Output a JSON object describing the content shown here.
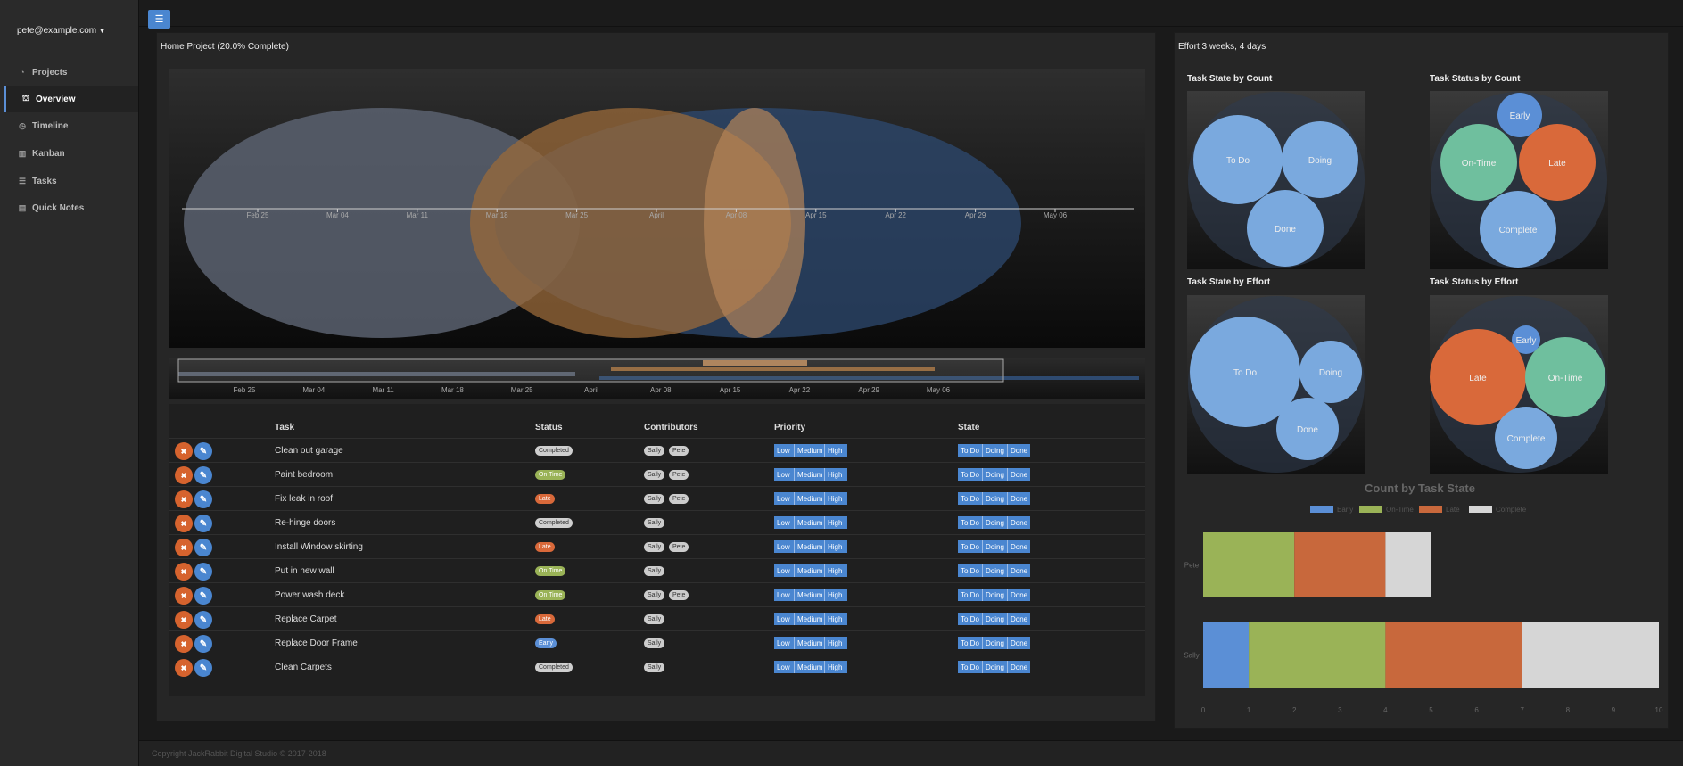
{
  "user": {
    "email": "pete@example.com"
  },
  "nav": [
    {
      "label": "Projects",
      "icon": "dashboard-icon",
      "glyph": "◔",
      "active": false
    },
    {
      "label": "Overview",
      "icon": "binoculars-icon",
      "glyph": "⛫",
      "active": true
    },
    {
      "label": "Timeline",
      "icon": "clock-icon",
      "glyph": "◷",
      "active": false
    },
    {
      "label": "Kanban",
      "icon": "columns-icon",
      "glyph": "▥",
      "active": false
    },
    {
      "label": "Tasks",
      "icon": "list-icon",
      "glyph": "☰",
      "active": false
    },
    {
      "label": "Quick Notes",
      "icon": "book-icon",
      "glyph": "▤",
      "active": false
    }
  ],
  "project": {
    "title": "Home Project (20.0% Complete)"
  },
  "effort": {
    "title": "Effort 3 weeks, 4 days"
  },
  "timeline": {
    "ticks": [
      "Feb 25",
      "Mar 04",
      "Mar 11",
      "Mar 18",
      "Mar 25",
      "April",
      "Apr 08",
      "Apr 15",
      "Apr 22",
      "Apr 29",
      "May 06"
    ],
    "nav_ticks": [
      "Feb 25",
      "Mar 04",
      "Mar 11",
      "Mar 18",
      "Mar 25",
      "April",
      "Apr 08",
      "Apr 15",
      "Apr 22",
      "Apr 29",
      "May 06"
    ]
  },
  "table": {
    "headers": {
      "task": "Task",
      "status": "Status",
      "contributors": "Contributors",
      "priority": "Priority",
      "state": "State"
    },
    "priority_labels": [
      "Low",
      "Medium",
      "High"
    ],
    "state_labels": [
      "To Do",
      "Doing",
      "Done"
    ],
    "rows": [
      {
        "task": "Clean out garage",
        "status": "Completed",
        "contributors": [
          "Sally",
          "Pete"
        ]
      },
      {
        "task": "Paint bedroom",
        "status": "On Time",
        "contributors": [
          "Sally",
          "Pete"
        ]
      },
      {
        "task": "Fix leak in roof",
        "status": "Late",
        "contributors": [
          "Sally",
          "Pete"
        ]
      },
      {
        "task": "Re-hinge doors",
        "status": "Completed",
        "contributors": [
          "Sally"
        ]
      },
      {
        "task": "Install Window skirting",
        "status": "Late",
        "contributors": [
          "Sally",
          "Pete"
        ]
      },
      {
        "task": "Put in new wall",
        "status": "On Time",
        "contributors": [
          "Sally"
        ]
      },
      {
        "task": "Power wash deck",
        "status": "On Time",
        "contributors": [
          "Sally",
          "Pete"
        ]
      },
      {
        "task": "Replace Carpet",
        "status": "Late",
        "contributors": [
          "Sally"
        ]
      },
      {
        "task": "Replace Door Frame",
        "status": "Early",
        "contributors": [
          "Sally"
        ]
      },
      {
        "task": "Clean Carpets",
        "status": "Completed",
        "contributors": [
          "Sally"
        ]
      }
    ]
  },
  "colors": {
    "early": "#5b8fd6",
    "on_time": "#9ab357",
    "late": "#c8683c",
    "complete": "#d6d6d6",
    "state": "#7aa9de",
    "status_ontime": "#6fbf9e",
    "status_late": "#d9693a"
  },
  "packs": [
    {
      "title": "Task State by Count",
      "bubbles": [
        {
          "label": "To Do"
        },
        {
          "label": "Doing"
        },
        {
          "label": "Done"
        }
      ]
    },
    {
      "title": "Task Status by Count",
      "bubbles": [
        {
          "label": "Early"
        },
        {
          "label": "On-Time"
        },
        {
          "label": "Late"
        },
        {
          "label": "Complete"
        }
      ]
    },
    {
      "title": "Task State by Effort",
      "bubbles": [
        {
          "label": "To Do"
        },
        {
          "label": "Doing"
        },
        {
          "label": "Done"
        }
      ]
    },
    {
      "title": "Task Status by Effort",
      "bubbles": [
        {
          "label": "Early"
        },
        {
          "label": "Late"
        },
        {
          "label": "On-Time"
        },
        {
          "label": "Complete"
        }
      ]
    }
  ],
  "chart_data": {
    "type": "bar",
    "orientation": "horizontal",
    "stacked": true,
    "title": "Count by Task State",
    "categories": [
      "Pete",
      "Sally"
    ],
    "series": [
      {
        "name": "Early",
        "values": [
          0,
          1
        ]
      },
      {
        "name": "On-Time",
        "values": [
          2,
          3
        ]
      },
      {
        "name": "Late",
        "values": [
          2,
          3
        ]
      },
      {
        "name": "Complete",
        "values": [
          1,
          3
        ]
      }
    ],
    "xlim": [
      0,
      10
    ],
    "xticks": [
      "0",
      "1",
      "2",
      "3",
      "4",
      "5",
      "6",
      "7",
      "8",
      "9",
      "10"
    ],
    "legend": "top"
  },
  "footer": {
    "text": "Copyright JackRabbit Digital Studio © 2017-2018"
  }
}
